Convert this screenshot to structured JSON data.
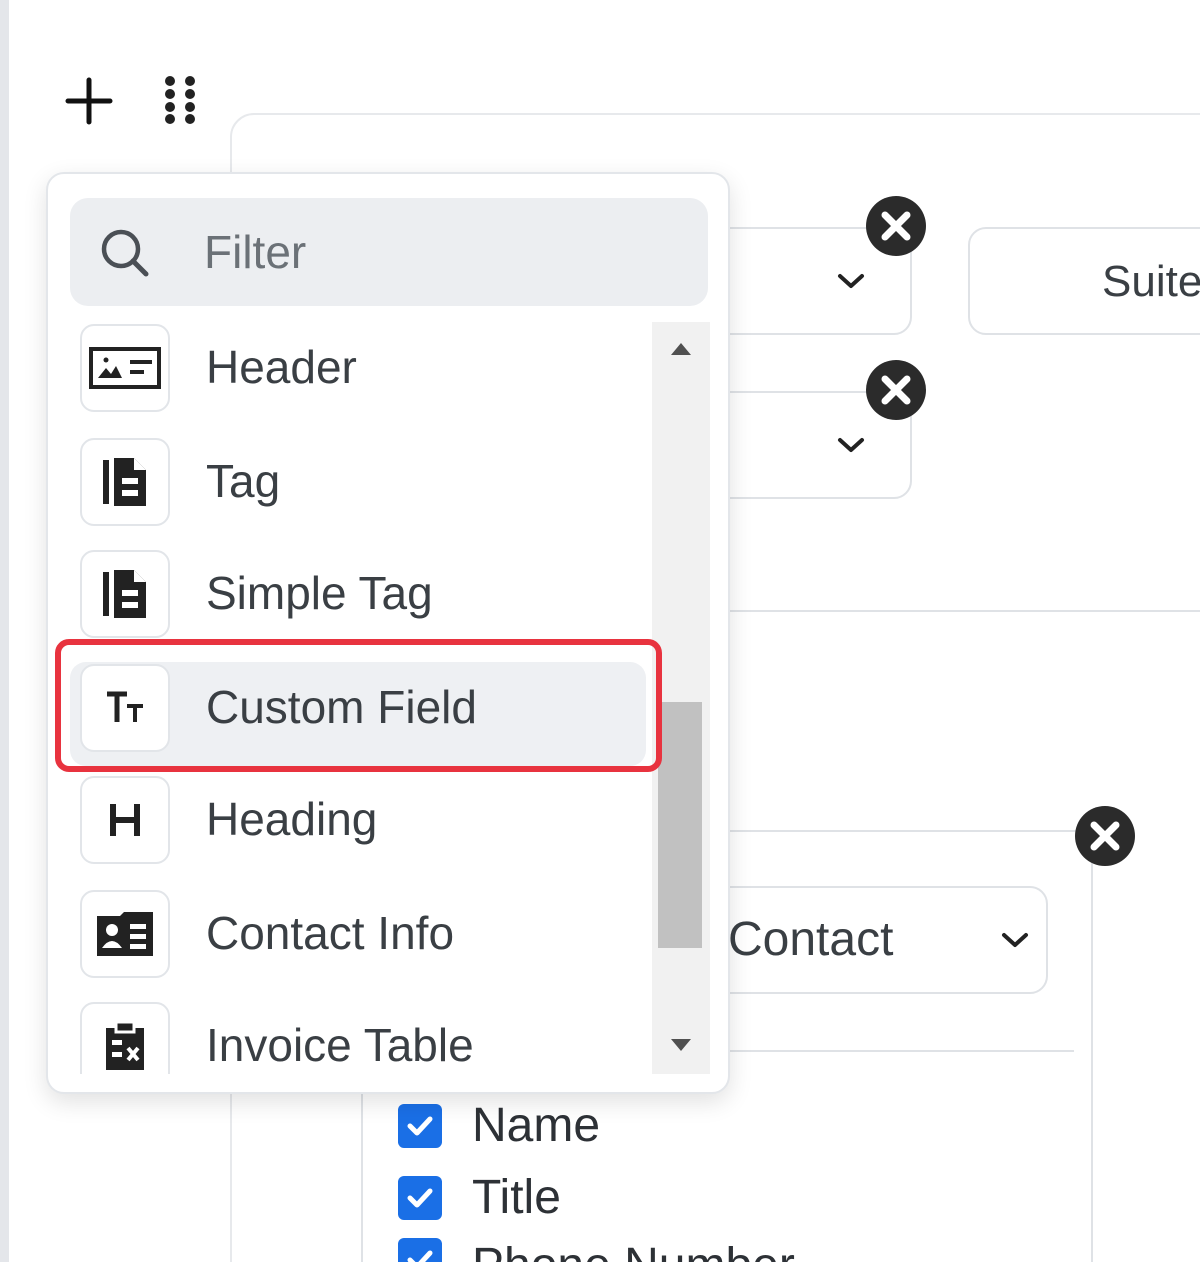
{
  "toolbar": {
    "add_icon": "plus-icon",
    "drag_icon": "drag-handle-icon"
  },
  "background": {
    "suite_value": "Suite",
    "contact_select_value": "Contact",
    "checkboxes": [
      {
        "label": "Name",
        "checked": true
      },
      {
        "label": "Title",
        "checked": true
      },
      {
        "label": "Phone Number",
        "checked": true
      }
    ]
  },
  "dropdown": {
    "filter": {
      "placeholder": "Filter",
      "value": ""
    },
    "items": [
      {
        "label": "Header",
        "icon": "header-image-icon"
      },
      {
        "label": "Tag",
        "icon": "document-tag-icon"
      },
      {
        "label": "Simple Tag",
        "icon": "document-tag-icon"
      },
      {
        "label": "Custom Field",
        "icon": "text-size-icon",
        "selected": true
      },
      {
        "label": "Heading",
        "icon": "heading-icon"
      },
      {
        "label": "Contact Info",
        "icon": "contact-card-icon"
      },
      {
        "label": "Invoice Table",
        "icon": "clipboard-icon"
      }
    ],
    "scroll_position": 0.65
  },
  "colors": {
    "highlight": "#e8333f",
    "checkbox": "#1a6fe6",
    "close_badge": "#2b2b2b"
  }
}
